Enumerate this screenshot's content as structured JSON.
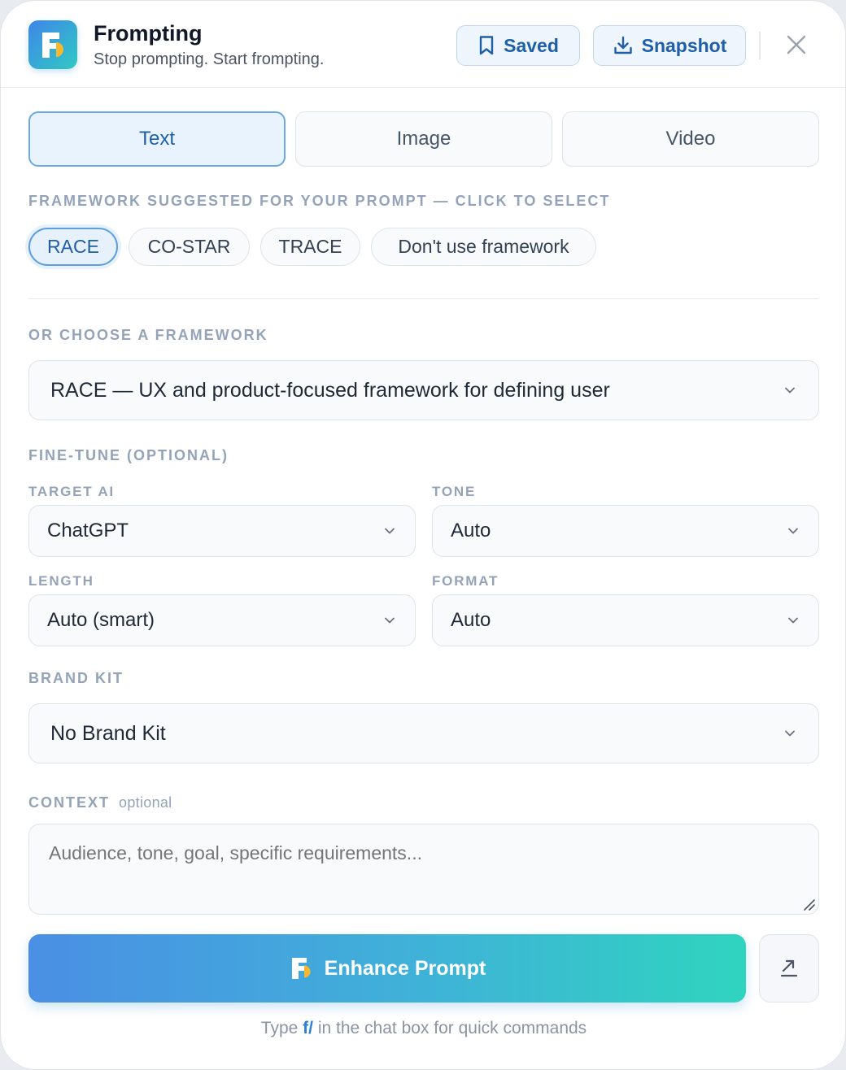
{
  "header": {
    "title": "Frompting",
    "subtitle": "Stop prompting. Start frompting.",
    "saved_label": "Saved",
    "snapshot_label": "Snapshot"
  },
  "tabs": [
    {
      "label": "Text",
      "active": true
    },
    {
      "label": "Image",
      "active": false
    },
    {
      "label": "Video",
      "active": false
    }
  ],
  "suggested": {
    "label": "FRAMEWORK SUGGESTED FOR YOUR PROMPT — CLICK TO SELECT",
    "chips": [
      {
        "label": "RACE",
        "active": true
      },
      {
        "label": "CO-STAR",
        "active": false
      },
      {
        "label": "TRACE",
        "active": false
      },
      {
        "label": "Don't use framework",
        "active": false
      }
    ]
  },
  "framework": {
    "label": "OR CHOOSE A FRAMEWORK",
    "selected": "RACE — UX and product-focused framework for defining user"
  },
  "finetune": {
    "label": "FINE-TUNE (OPTIONAL)",
    "target_ai": {
      "label": "TARGET AI",
      "value": "ChatGPT"
    },
    "tone": {
      "label": "TONE",
      "value": "Auto"
    },
    "length": {
      "label": "LENGTH",
      "value": "Auto (smart)"
    },
    "format": {
      "label": "FORMAT",
      "value": "Auto"
    }
  },
  "brand_kit": {
    "label": "BRAND KIT",
    "value": "No Brand Kit"
  },
  "context": {
    "label": "CONTEXT",
    "optional": "optional",
    "placeholder": "Audience, tone, goal, specific requirements..."
  },
  "enhance_label": "Enhance Prompt",
  "footer": {
    "prefix": "Type",
    "command": "f/",
    "suffix": "in the chat box for quick commands"
  },
  "colors": {
    "accent": "#1e5fa6",
    "gradient_start": "#4a8fe4",
    "gradient_end": "#2fd4bf"
  }
}
